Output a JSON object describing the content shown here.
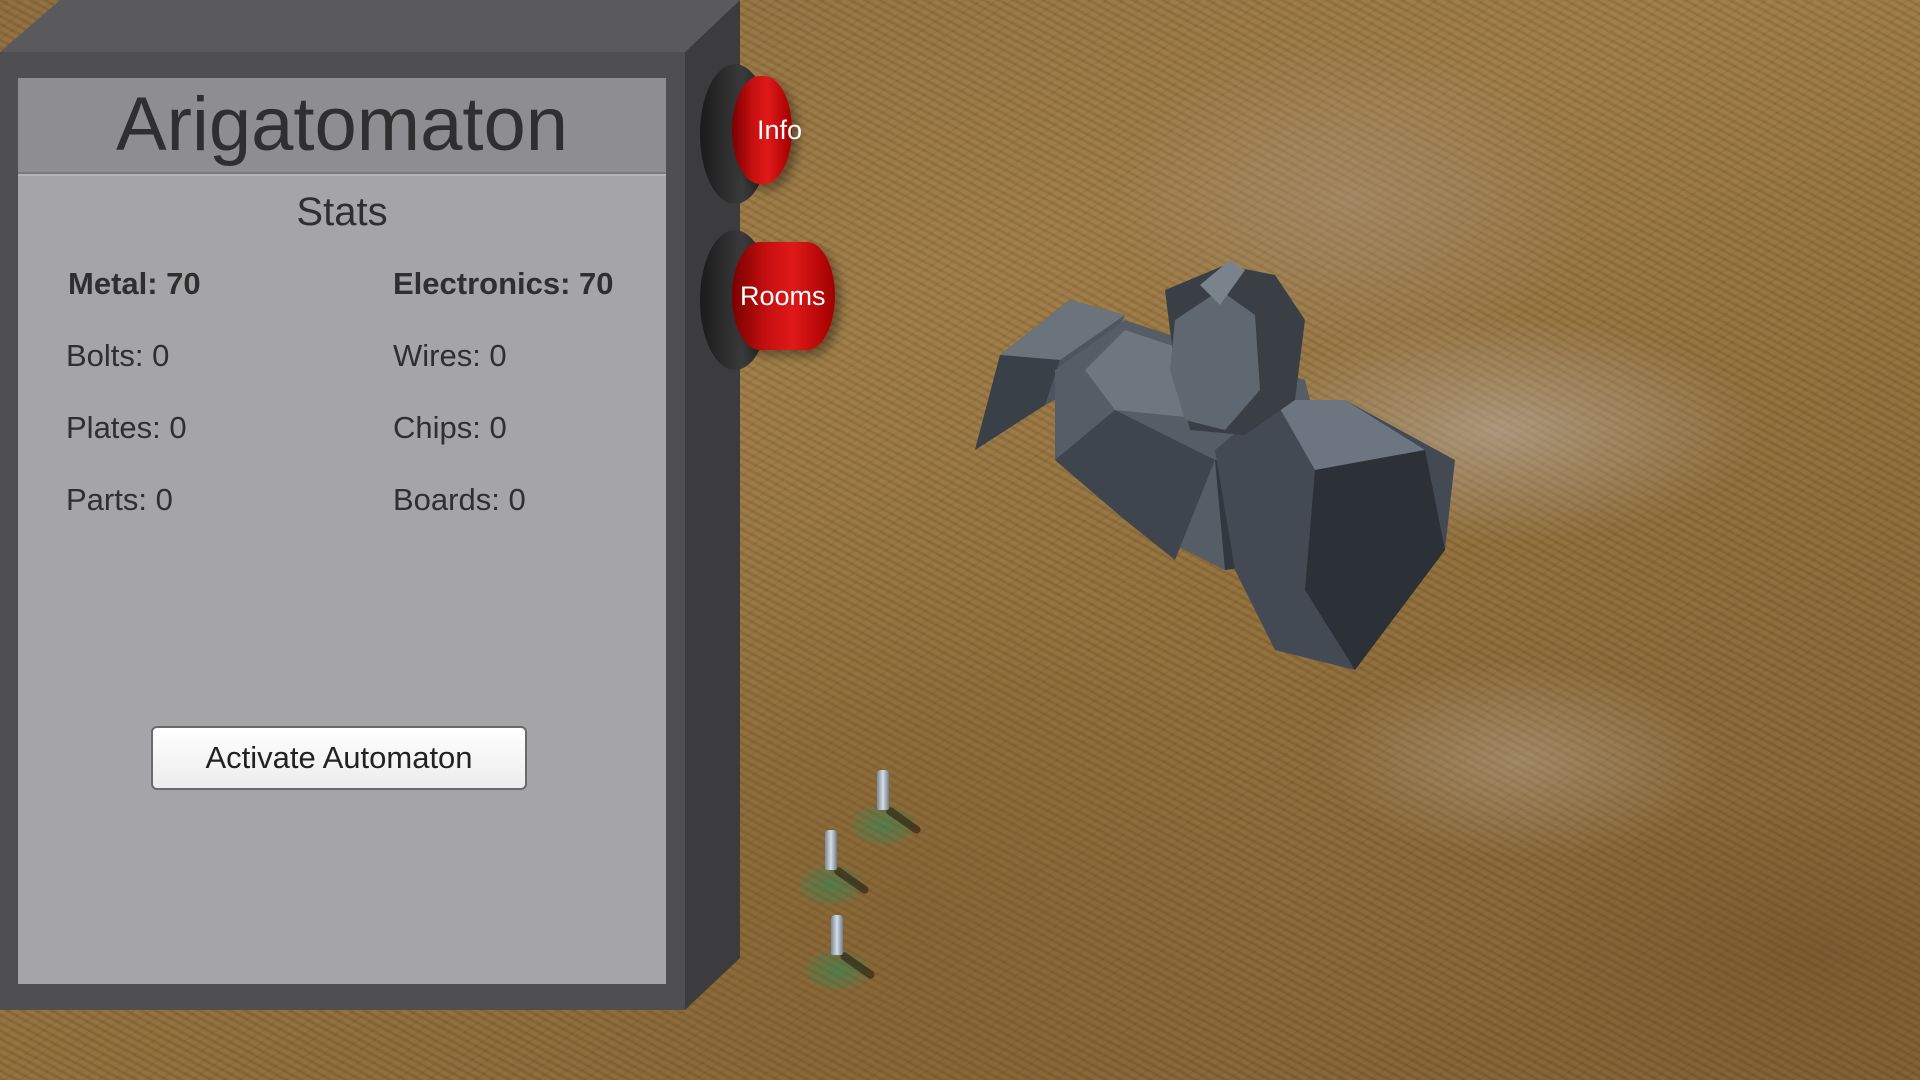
{
  "panel": {
    "title": "Arigatomaton",
    "stats_heading": "Stats",
    "stats": {
      "metal": "Metal: 70",
      "electronics": "Electronics: 70",
      "bolts": "Bolts: 0",
      "wires": "Wires: 0",
      "plates": "Plates: 0",
      "chips": "Chips: 0",
      "parts": "Parts: 0",
      "boards": "Boards: 0"
    },
    "activate_button": "Activate Automaton"
  },
  "side_buttons": {
    "info": "Info",
    "rooms": "Rooms"
  },
  "colors": {
    "button_red": "#d01414",
    "panel_gray": "#a5a5a7",
    "panel_frame": "#4f4f52",
    "ground": "#8d6c3a"
  },
  "scene": {
    "structure": "sphinx-building",
    "units": [
      "unit",
      "unit",
      "unit"
    ]
  }
}
